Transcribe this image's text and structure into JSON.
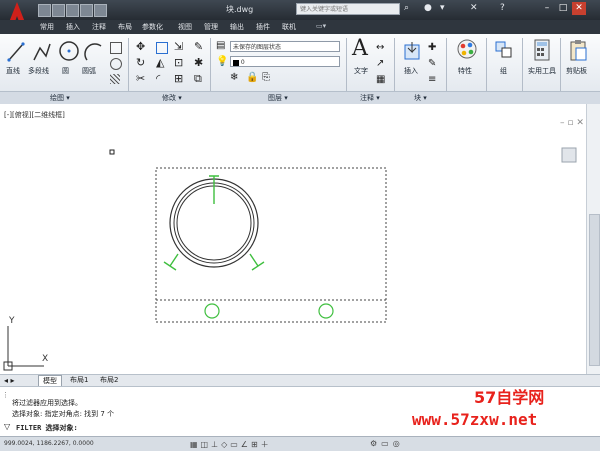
{
  "window": {
    "title": "块.dwg",
    "search_placeholder": "键入关键字或短语",
    "user_icon": "user-icon"
  },
  "menu": [
    "常用",
    "插入",
    "注释",
    "布局",
    "参数化",
    "视图",
    "管理",
    "输出",
    "插件",
    "联机"
  ],
  "ribbon": {
    "draw": {
      "line": "直线",
      "polyline": "多段线",
      "circle": "圆",
      "arc": "圆弧",
      "panel": "绘图 ▾"
    },
    "modify": {
      "panel": "修改 ▾"
    },
    "layers": {
      "layer_state": "未保存的图层状态",
      "current_layer": "0",
      "panel": "图层 ▾"
    },
    "annotation": {
      "text": "文字",
      "panel": "注释 ▾"
    },
    "block": {
      "insert": "插入",
      "panel": "块 ▾"
    },
    "properties": {
      "label": "特性"
    },
    "groups": {
      "label": "组"
    },
    "utilities": {
      "label": "实用工具"
    },
    "clipboard": {
      "label": "剪贴板"
    }
  },
  "viewport": {
    "label": "[-][俯视][二维线框]",
    "ucs_y": "Y",
    "ucs_x": "X"
  },
  "tabs": [
    "模型",
    "布局1",
    "布局2"
  ],
  "command": {
    "line1": "将过滤器应用到选择。",
    "line2": "选择对象: 指定对角点: 找到 7 个",
    "prompt": "FILTER 选择对象:"
  },
  "status": {
    "coords": "999.0024, 1186.2267, 0.0000"
  },
  "watermark": {
    "name": "57自学网",
    "url": "www.57zxw.net"
  },
  "colors": {
    "titlebar": "#2f363e",
    "ribbon": "#e8edf2",
    "grips": "#3fbf3f",
    "watermark": "#e8221c"
  }
}
